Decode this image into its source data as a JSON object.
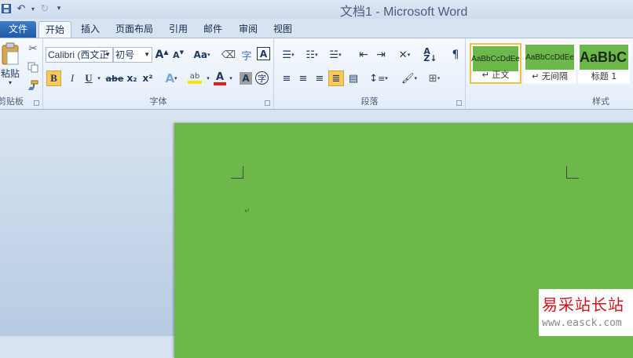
{
  "window": {
    "title": "文档1 - Microsoft Word"
  },
  "tabs": [
    {
      "label": "文件"
    },
    {
      "label": "开始"
    },
    {
      "label": "插入"
    },
    {
      "label": "页面布局"
    },
    {
      "label": "引用"
    },
    {
      "label": "邮件"
    },
    {
      "label": "审阅"
    },
    {
      "label": "视图"
    }
  ],
  "clipboard": {
    "paste_label": "粘贴",
    "group_label": "剪贴板"
  },
  "font": {
    "name": "Calibri (西文正",
    "size": "初号",
    "group_label": "字体",
    "bold": "B",
    "italic": "I",
    "underline": "U",
    "strike": "abe",
    "sub": "x₂",
    "sup": "x²",
    "case": "Aa",
    "grow": "A",
    "shrink": "A"
  },
  "paragraph": {
    "group_label": "段落"
  },
  "styles": {
    "group_label": "样式",
    "items": [
      {
        "preview": "AaBbCcDdEe",
        "label": "↵ 正文"
      },
      {
        "preview": "AaBbCcDdEe",
        "label": "↵ 无间隔"
      },
      {
        "preview": "AaBbC",
        "label": "标题 1"
      }
    ]
  },
  "document": {
    "page_color": "#6cb94a"
  },
  "watermark": {
    "line1": "易采站长站",
    "line2": "www.easck.com"
  },
  "colors": {
    "font_color_bar": "#e02020",
    "highlight_bar": "#ffe000",
    "file_tab": "#2a68b5"
  }
}
